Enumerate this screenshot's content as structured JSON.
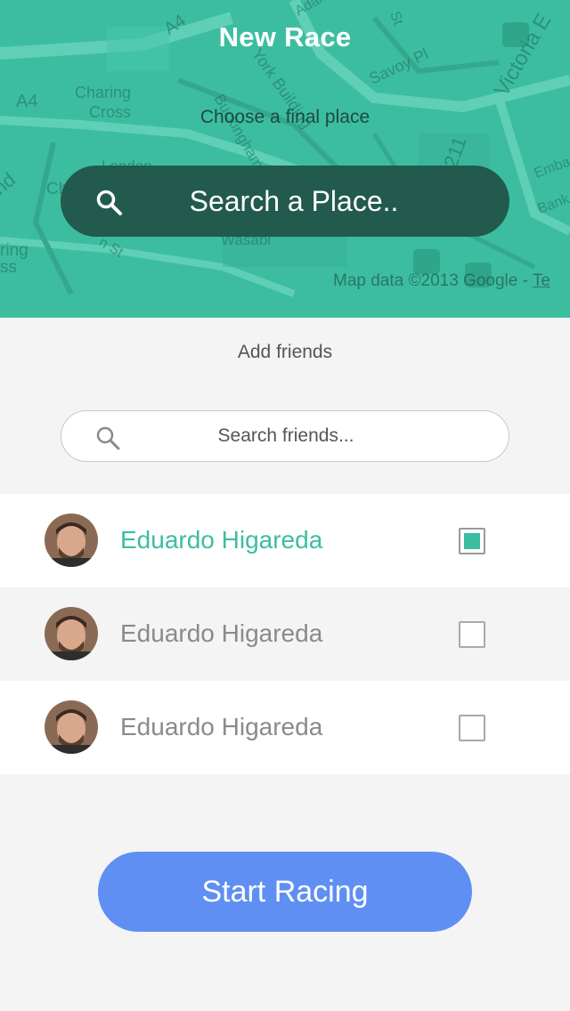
{
  "header": {
    "title": "New Race",
    "subtitle": "Choose a final place",
    "place_search_placeholder": "Search a Place..",
    "map_credit": "Map data ©2013 Google - ",
    "map_credit_link": "Te",
    "map_labels": [
      "A4",
      "A4",
      "Charing",
      "Cross",
      "London",
      "York Building",
      "Buckingham St",
      "Savoy Pl",
      "Adam",
      "Victoria E",
      "Emba",
      "Bank",
      "211",
      "Wasabi",
      "ring",
      "ss",
      "nd",
      "Ch",
      "n St",
      "St"
    ]
  },
  "friends": {
    "heading": "Add friends",
    "search_placeholder": "Search friends...",
    "items": [
      {
        "name": "Eduardo Higareda",
        "checked": true
      },
      {
        "name": "Eduardo Higareda",
        "checked": false
      },
      {
        "name": "Eduardo Higareda",
        "checked": false
      }
    ]
  },
  "actions": {
    "start_label": "Start Racing"
  },
  "colors": {
    "accent": "#3dbda0",
    "search_pill": "#225a4e",
    "primary_button": "#5f8ff2"
  },
  "icons": {
    "place_search": "search-icon",
    "friend_search": "search-icon",
    "avatar": "user-avatar"
  }
}
